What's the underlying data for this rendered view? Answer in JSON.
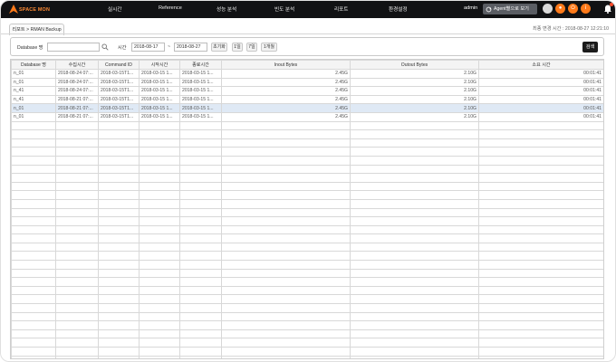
{
  "app": {
    "logo_text": "SPACE MON",
    "nav": [
      "실시간",
      "Reference",
      "성능 분석",
      "빈도 분석",
      "리포트",
      "환경설정"
    ],
    "user": "admin",
    "agent_button": "Agent별으로 보기",
    "colors": {
      "topbar": "#111214",
      "accent": "#ff7a1a",
      "selected_row": "#dfe9f5"
    }
  },
  "tab": {
    "label": "리포트 > RMAN Backup"
  },
  "last_updated": "최종 변경 시간 : 2018-08-27 12:21:10",
  "search": {
    "db_label": "Database 명",
    "db_value": "",
    "time_label": "시간",
    "date_from": "2018-08-17",
    "tilde": "~",
    "date_to": "2018-08-27",
    "quick": [
      "초기화",
      "1일",
      "7일",
      "1개월"
    ],
    "submit": "검색"
  },
  "table": {
    "headers": [
      "Database 명",
      "수집시간",
      "Command ID",
      "시작시간",
      "종료시간",
      "Inout Bytes",
      "Outout Bytes",
      "소요 시간"
    ],
    "rows": [
      [
        "n_01",
        "2018-08-24 07:...",
        "2018-03-15T1...",
        "2018-03-15 1...",
        "2018-03-15 1...",
        "2.45G",
        "2.10G",
        "00:01:41"
      ],
      [
        "n_01",
        "2018-08-24 07:...",
        "2018-03-15T1...",
        "2018-03-15 1...",
        "2018-03-15 1...",
        "2.45G",
        "2.10G",
        "00:01:41"
      ],
      [
        "n_41",
        "2018-08-24 07:...",
        "2018-03-15T1...",
        "2018-03-15 1...",
        "2018-03-15 1...",
        "2.45G",
        "2.10G",
        "00:01:41"
      ],
      [
        "n_41",
        "2018-08-21 07:...",
        "2018-03-15T1...",
        "2018-03-15 1...",
        "2018-03-15 1...",
        "2.45G",
        "2.10G",
        "00:01:41"
      ],
      [
        "n_01",
        "2018-08-21 07:...",
        "2018-03-15T1...",
        "2018-03-15 1...",
        "2018-03-15 1...",
        "2.45G",
        "2.10G",
        "00:01:41"
      ],
      [
        "n_01",
        "2018-08-21 07:...",
        "2018-03-15T1...",
        "2018-03-15 1...",
        "2018-03-15 1...",
        "2.45G",
        "2.10G",
        "00:01:41"
      ]
    ],
    "selected_row": 4
  }
}
